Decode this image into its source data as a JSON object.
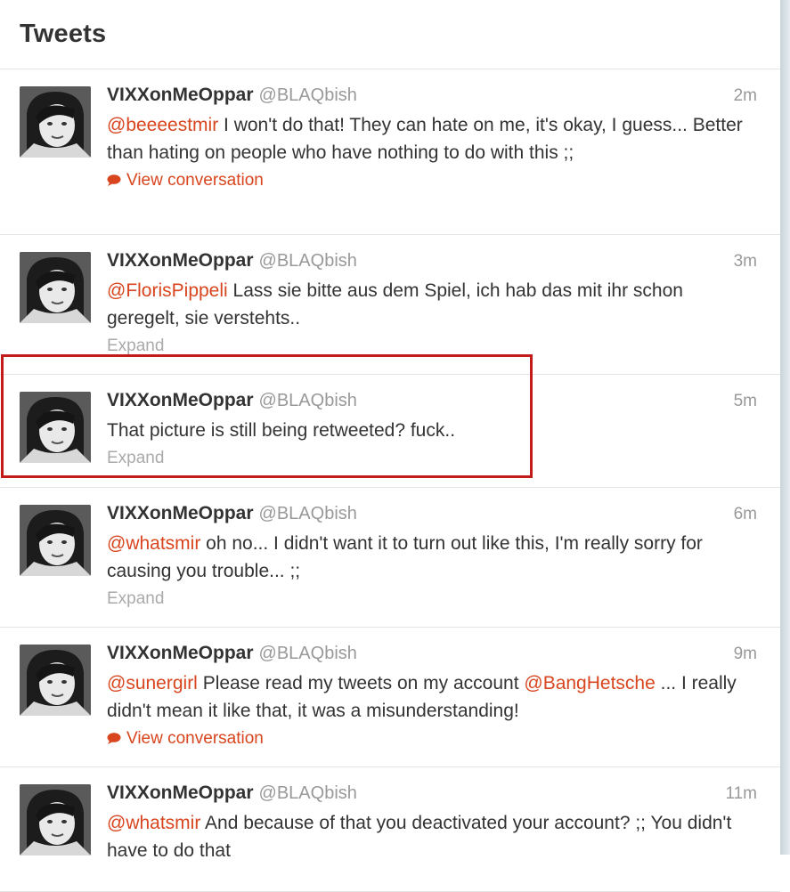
{
  "header": {
    "title": "Tweets"
  },
  "colors": {
    "mention": "#d8451e",
    "highlight": "#c31a1a"
  },
  "icons": {
    "conversation": "speech-bubble-icon"
  },
  "tweets": [
    {
      "name": "VIXXonMeOppar",
      "handle": "@BLAQbish",
      "time": "2m",
      "mention": "@beeeestmir",
      "text": " I won't do that! They can hate on me, it's okay, I guess... Better than hating on people who have nothing to do with this ;;",
      "action": "View conversation"
    },
    {
      "name": "VIXXonMeOppar",
      "handle": "@BLAQbish",
      "time": "3m",
      "mention": "@FlorisPippeli",
      "text": " Lass sie bitte aus dem Spiel, ich hab das mit ihr schon geregelt, sie verstehts..",
      "action": "Expand"
    },
    {
      "name": "VIXXonMeOppar",
      "handle": "@BLAQbish",
      "time": "5m",
      "mention": "",
      "text": "That picture is still being retweeted? fuck..",
      "action": "Expand"
    },
    {
      "name": "VIXXonMeOppar",
      "handle": "@BLAQbish",
      "time": "6m",
      "mention": "@whatsmir",
      "text": " oh no... I didn't want it to turn out like this, I'm really sorry for causing you trouble... ;;",
      "action": "Expand"
    },
    {
      "name": "VIXXonMeOppar",
      "handle": "@BLAQbish",
      "time": "9m",
      "mention": "@sunergirl",
      "text": " Please read my tweets on my account ",
      "mention2": "@BangHetsche",
      "text2": " ... I really didn't mean it like that, it was a misunderstanding!",
      "action": "View conversation"
    },
    {
      "name": "VIXXonMeOppar",
      "handle": "@BLAQbish",
      "time": "11m",
      "mention": "@whatsmir",
      "text": " And because of that you deactivated your account? ;; You didn't have to do that",
      "action": ""
    }
  ]
}
